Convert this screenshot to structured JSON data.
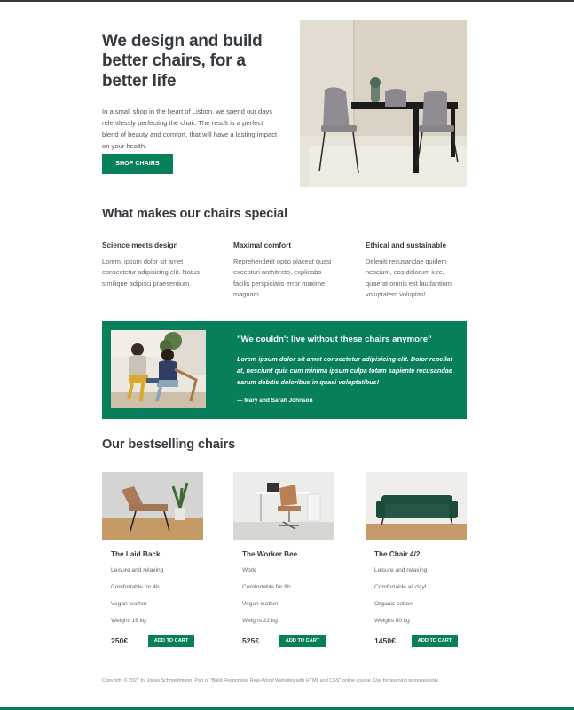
{
  "hero": {
    "title": "We design and build better chairs, for a better life",
    "description": "In a small shop in the heart of Lisbon, we spend our days relentlessly perfecting the chair. The result is a perfect blend of beauty and comfort, that will have a lasting impact on your health.",
    "cta_label": "SHOP CHAIRS",
    "image_icon": "dining-table-chairs-photo"
  },
  "special": {
    "title": "What makes our chairs special",
    "features": [
      {
        "title": "Science meets design",
        "text": "Lorem, ipsum dolor sit amet consectetur adipisicing elit. Natus similique adipisci praesentium."
      },
      {
        "title": "Maximal comfort",
        "text": "Reprehenderit optio placeat quasi excepturi architecto, explicabo facilis perspiciatis error maxime magnam."
      },
      {
        "title": "Ethical and sustainable",
        "text": "Deleniti recusandae quidem nesciunt, eos dolorum iure, quaerat omnis est laudantium voluptatem voluptas!"
      }
    ]
  },
  "testimonial": {
    "quote": "\"We couldn't live without these chairs anymore\"",
    "text": "Lorem ipsum dolor sit amet consectetur adipisicing elit. Dolor repellat at, nesciunt quia cum minima ipsum culpa totam sapiente recusandae earum debitis doloribus in quasi voluptatibus!",
    "author": "— Mary and Sarah Johnson",
    "image_icon": "two-women-sitting-photo"
  },
  "bestselling": {
    "title": "Our bestselling chairs",
    "cart_label": "ADD TO CART",
    "products": [
      {
        "name": "The Laid Back",
        "attrs": [
          "Leisure and relaxing",
          "Comfortable for 4h",
          "Vegan leather",
          "Weighs 16 kg"
        ],
        "price": "250€"
      },
      {
        "name": "The Worker Bee",
        "attrs": [
          "Work",
          "Comfortable for 8h",
          "Vegan leather",
          "Weighs 22 kg"
        ],
        "price": "525€"
      },
      {
        "name": "The Chair 4/2",
        "attrs": [
          "Leisure and relaxing",
          "Comfortable all day!",
          "Organic cotton",
          "Weighs 80 kg"
        ],
        "price": "1450€"
      }
    ]
  },
  "footer": {
    "text": "Copyright © 2027 by Jonas Schmedtmann. Part of \"Build Responsive Real-World Websites with HTML and CSS\" online course. Use for learning purposes only."
  },
  "colors": {
    "accent": "#087f5b",
    "text": "#343a40",
    "muted": "#666666"
  }
}
